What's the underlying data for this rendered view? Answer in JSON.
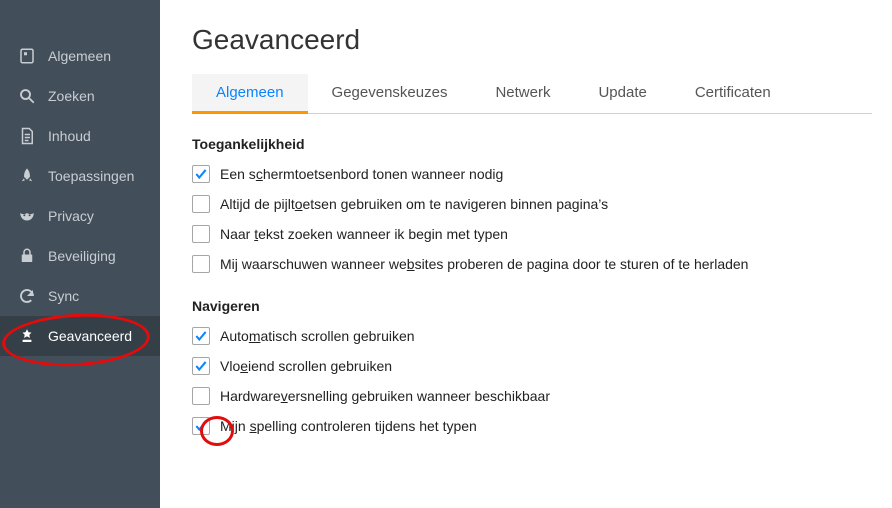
{
  "sidebar": {
    "items": [
      {
        "label": "Algemeen",
        "icon": "prefs-icon",
        "selected": false
      },
      {
        "label": "Zoeken",
        "icon": "search-icon",
        "selected": false
      },
      {
        "label": "Inhoud",
        "icon": "document-icon",
        "selected": false
      },
      {
        "label": "Toepassingen",
        "icon": "rocket-icon",
        "selected": false
      },
      {
        "label": "Privacy",
        "icon": "mask-icon",
        "selected": false
      },
      {
        "label": "Beveiliging",
        "icon": "lock-icon",
        "selected": false
      },
      {
        "label": "Sync",
        "icon": "sync-icon",
        "selected": false
      },
      {
        "label": "Geavanceerd",
        "icon": "advanced-icon",
        "selected": true
      }
    ]
  },
  "page": {
    "title": "Geavanceerd"
  },
  "tabs": [
    {
      "label": "Algemeen",
      "active": true
    },
    {
      "label": "Gegevenskeuzes",
      "active": false
    },
    {
      "label": "Netwerk",
      "active": false
    },
    {
      "label": "Update",
      "active": false
    },
    {
      "label": "Certificaten",
      "active": false
    }
  ],
  "sections": {
    "accessibility": {
      "title": "Toegankelijkheid",
      "items": [
        {
          "checked": true,
          "label_html": "Een s<u>c</u>hermtoetsenbord tonen wanneer nodig"
        },
        {
          "checked": false,
          "label_html": "Altijd de pijlt<u>o</u>etsen gebruiken om te navigeren binnen pagina’s"
        },
        {
          "checked": false,
          "label_html": "Naar <u>t</u>ekst zoeken wanneer ik begin met typen"
        },
        {
          "checked": false,
          "label_html": "Mij waarschuwen wanneer we<u>b</u>sites proberen de pagina door te sturen of te herladen"
        }
      ]
    },
    "browsing": {
      "title": "Navigeren",
      "items": [
        {
          "checked": true,
          "label_html": "Auto<u>m</u>atisch scrollen gebruiken"
        },
        {
          "checked": true,
          "label_html": "Vlo<u>e</u>iend scrollen gebruiken"
        },
        {
          "checked": false,
          "label_html": "Hardware<u>v</u>ersnelling gebruiken wanneer beschikbaar"
        },
        {
          "checked": true,
          "label_html": "Mijn <u>s</u>pelling controleren tijdens het typen"
        }
      ]
    }
  }
}
